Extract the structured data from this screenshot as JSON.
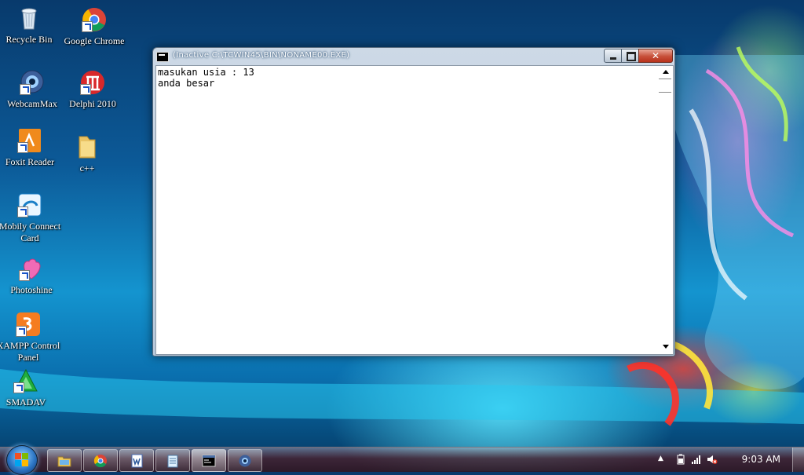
{
  "desktop": {
    "icons": [
      {
        "label": "Recycle Bin",
        "icon": "recycle-bin-icon"
      },
      {
        "label": "Google Chrome",
        "icon": "chrome-icon"
      },
      {
        "label": "WebcamMax",
        "icon": "webcam-icon"
      },
      {
        "label": "Delphi 2010",
        "icon": "delphi-icon"
      },
      {
        "label": "Foxit Reader",
        "icon": "foxit-reader-icon"
      },
      {
        "label": "c++",
        "icon": "folder-icon"
      },
      {
        "label": "Mobily Connect Card",
        "icon": "mobily-icon"
      },
      {
        "label": "Photoshine",
        "icon": "photoshine-icon"
      },
      {
        "label": "XAMPP Control Panel",
        "icon": "xampp-icon"
      },
      {
        "label": "SMADAV",
        "icon": "smadav-icon"
      }
    ]
  },
  "window": {
    "title": "(Inactive C:\\TCWIN45\\BIN\\NONAME00.EXE)",
    "close_glyph": "✕",
    "console_lines": [
      "masukan usia : 13",
      "anda besar"
    ]
  },
  "taskbar": {
    "buttons": [
      {
        "name": "explorer",
        "icon": "explorer-folder-icon"
      },
      {
        "name": "chrome",
        "icon": "chrome-icon"
      },
      {
        "name": "word",
        "icon": "word-icon"
      },
      {
        "name": "notepad",
        "icon": "notepad-icon"
      },
      {
        "name": "console",
        "icon": "console-icon",
        "active": true
      },
      {
        "name": "webcammax",
        "icon": "webcam-icon"
      }
    ],
    "tray_arrow": "▲",
    "clock": "9:03 AM",
    "colors": {
      "start_orb": "#2d77c6",
      "close_button": "#c7503a"
    }
  }
}
